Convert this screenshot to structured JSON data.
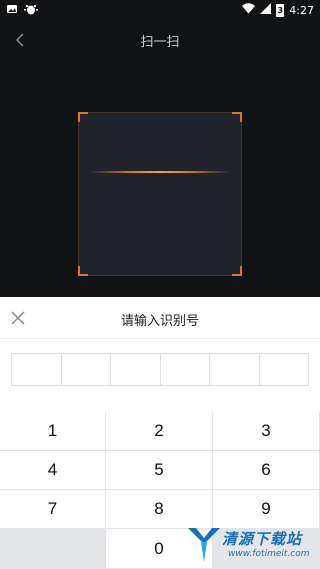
{
  "status_bar": {
    "time": "4:27",
    "battery_badge": "3"
  },
  "header": {
    "title": "扫一扫"
  },
  "sheet": {
    "title": "请输入识别号",
    "code_digits": [
      "",
      "",
      "",
      "",
      "",
      ""
    ]
  },
  "keypad": {
    "keys": [
      "1",
      "2",
      "3",
      "4",
      "5",
      "6",
      "7",
      "8",
      "9",
      "",
      "0",
      ""
    ]
  },
  "watermark": {
    "text": "清源下载站",
    "url": "www.fotimeit.com"
  },
  "colors": {
    "accent": "#e07a14",
    "background": "#111214"
  }
}
